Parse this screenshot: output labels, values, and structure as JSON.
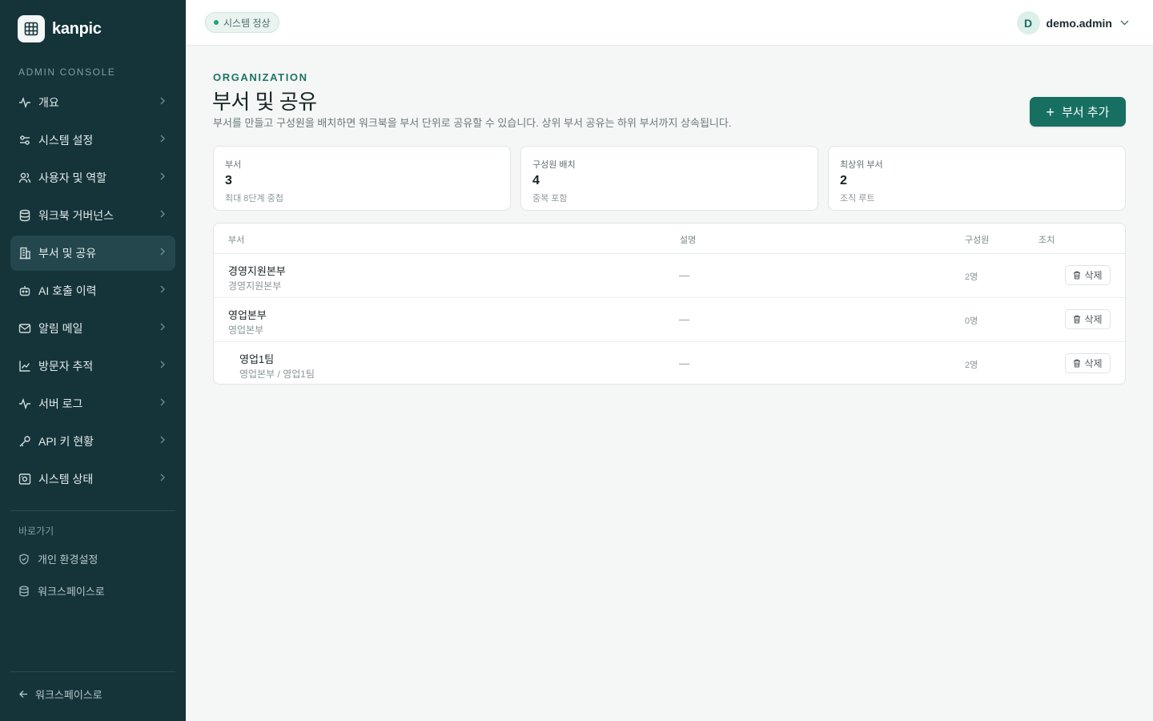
{
  "brand": {
    "name": "kanpic",
    "logo_icon": "grid-icon"
  },
  "sidebar": {
    "section_label": "ADMIN CONSOLE",
    "items": [
      {
        "label": "개요",
        "icon": "activity-icon",
        "active": false
      },
      {
        "label": "시스템 설정",
        "icon": "sliders-icon",
        "active": false
      },
      {
        "label": "사용자 및 역할",
        "icon": "users-icon",
        "active": false
      },
      {
        "label": "워크북 거버넌스",
        "icon": "database-icon",
        "active": false
      },
      {
        "label": "부서 및 공유",
        "icon": "building-icon",
        "active": true
      },
      {
        "label": "AI 호출 이력",
        "icon": "bot-icon",
        "active": false
      },
      {
        "label": "알림 메일",
        "icon": "mail-icon",
        "active": false
      },
      {
        "label": "방문자 추적",
        "icon": "line-chart-icon",
        "active": false
      },
      {
        "label": "서버 로그",
        "icon": "activity-icon",
        "active": false
      },
      {
        "label": "API 키 현황",
        "icon": "key-icon",
        "active": false
      },
      {
        "label": "시스템 상태",
        "icon": "monitor-icon",
        "active": false
      }
    ],
    "quick_label": "바로가기",
    "quick_items": [
      {
        "label": "개인 환경설정",
        "icon": "shield-icon"
      },
      {
        "label": "워크스페이스로",
        "icon": "database-icon"
      }
    ],
    "back_label": "워크스페이스로"
  },
  "topbar": {
    "status": "시스템 정상",
    "status_color": "#20a27a",
    "user_initial": "D",
    "user_name": "demo.admin"
  },
  "page": {
    "eyebrow": "ORGANIZATION",
    "title": "부서 및 공유",
    "description": "부서를 만들고 구성원을 배치하면 워크북을 부서 단위로 공유할 수 있습니다. 상위 부서 공유는 하위 부서까지 상속됩니다.",
    "add_button": "부서 추가",
    "accent_color": "#176f61"
  },
  "stats": [
    {
      "label": "부서",
      "value": "3",
      "sub": "최대 8단계 중첩"
    },
    {
      "label": "구성원 배치",
      "value": "4",
      "sub": "중복 포함"
    },
    {
      "label": "최상위 부서",
      "value": "2",
      "sub": "조직 루트"
    }
  ],
  "table": {
    "headers": {
      "dept": "부서",
      "desc": "설명",
      "members": "구성원",
      "action": "조치"
    },
    "rows": [
      {
        "name": "경영지원본부",
        "path": "경영지원본부",
        "desc": "—",
        "count": "2명",
        "action": "삭제",
        "depth": 0
      },
      {
        "name": "영업본부",
        "path": "영업본부",
        "desc": "—",
        "count": "0명",
        "action": "삭제",
        "depth": 0
      },
      {
        "name": "영업1팀",
        "path": "영업본부 / 영업1팀",
        "desc": "—",
        "count": "2명",
        "action": "삭제",
        "depth": 1
      }
    ]
  }
}
